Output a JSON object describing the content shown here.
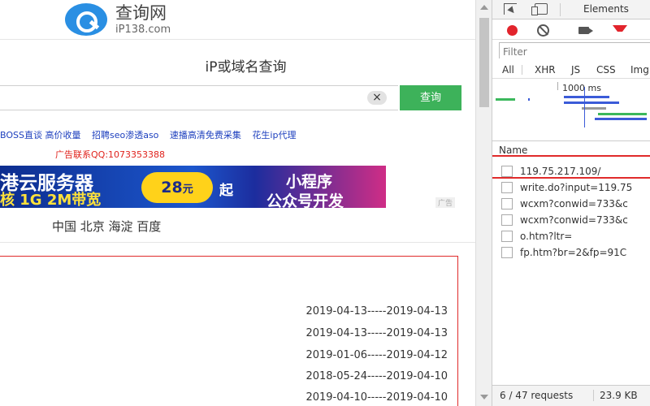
{
  "site": {
    "logo_cn": "查询网",
    "logo_en": "iP138.com",
    "query_title": "iP或域名查询",
    "search_value": "",
    "search_button": "查询",
    "clear_symbol": "×",
    "ad_links": [
      "BOSS直谈 高价收量",
      "招聘seo渗透aso",
      "速播高清免费采集",
      "花生ip代理"
    ],
    "ad_contact": "广告联系QQ:1073353388",
    "banner": {
      "line1": "港云服务器",
      "line2": "核 1G 2M带宽",
      "price": "28",
      "price_unit": "元",
      "qi": "起",
      "right1": "小程序",
      "right2": "公众号开发"
    },
    "ad_tag": "广告",
    "location": "中国 北京 海淀 百度",
    "records": [
      "2019-04-13-----2019-04-13",
      "2019-04-13-----2019-04-13",
      "2019-01-06-----2019-04-12",
      "2018-05-24-----2019-04-10",
      "2019-04-10-----2019-04-10"
    ]
  },
  "devtools": {
    "tab_elements": "Elements",
    "filter_placeholder": "Filter",
    "types": [
      "All",
      "XHR",
      "JS",
      "CSS",
      "Img"
    ],
    "timeline_label": "1000 ms",
    "name_header": "Name",
    "requests": [
      "119.75.217.109/",
      "write.do?input=119.75",
      "wcxm?conwid=733&c",
      "wcxm?conwid=733&c",
      "o.htm?ltr=",
      "fp.htm?br=2&fp=91C"
    ],
    "status_requests": "6 / 47 requests",
    "status_size": "23.9 KB"
  },
  "colors": {
    "search_button": "#3db25a",
    "highlight_border": "#e02b2b",
    "ad_link": "#1d3fbe",
    "ad_contact": "#e0231d",
    "record_icon": "#e2242c"
  }
}
